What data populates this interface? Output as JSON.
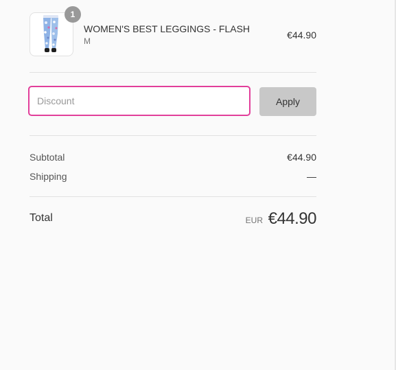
{
  "product": {
    "quantity": "1",
    "name": "WOMEN'S BEST LEGGINGS - FLASH",
    "variant": "M",
    "price": "€44.90",
    "image_icon": "leggings-product-image"
  },
  "discount": {
    "placeholder": "Discount",
    "value": "",
    "apply_label": "Apply"
  },
  "totals": {
    "subtotal_label": "Subtotal",
    "subtotal_value": "€44.90",
    "shipping_label": "Shipping",
    "shipping_value": "—",
    "total_label": "Total",
    "total_currency": "EUR",
    "total_value": "€44.90"
  },
  "colors": {
    "accent": "#e23e9a",
    "apply_button": "#c8c8c8",
    "badge": "#999999"
  }
}
